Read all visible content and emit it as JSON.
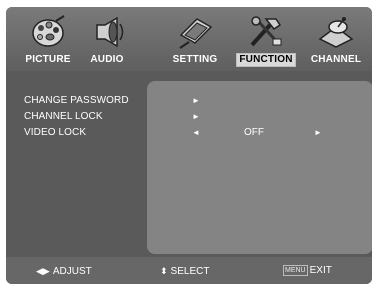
{
  "tabs": [
    {
      "label": "PICTURE",
      "icon": "picture-palette-icon",
      "selected": false
    },
    {
      "label": "AUDIO",
      "icon": "audio-speaker-icon",
      "selected": false
    },
    {
      "label": "SETTING",
      "icon": "setting-screen-icon",
      "selected": false
    },
    {
      "label": "FUNCTION",
      "icon": "function-tools-icon",
      "selected": true
    },
    {
      "label": "CHANNEL",
      "icon": "channel-satellite-icon",
      "selected": false
    }
  ],
  "rows": [
    {
      "label": "CHANGE PASSWORD",
      "right_arrow": "►"
    },
    {
      "label": "CHANNEL LOCK",
      "right_arrow": "►"
    },
    {
      "label": "VIDEO LOCK",
      "left_arrow": "◄",
      "value": "OFF",
      "right_arrow": "►"
    }
  ],
  "footer": {
    "adjust_glyph": "◀▶",
    "adjust": "ADJUST",
    "select_glyph": "⬍",
    "select": "SELECT",
    "menu_key": "MENU",
    "exit": "EXIT"
  }
}
